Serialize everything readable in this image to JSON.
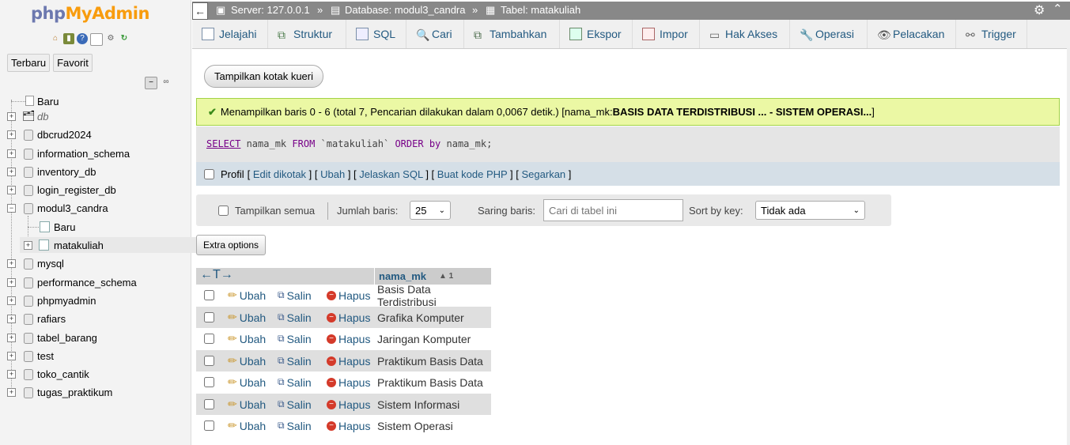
{
  "sidebar": {
    "logo_part1": "php",
    "logo_part2": "MyAdmin",
    "tabs": [
      "Terbaru",
      "Favorit"
    ],
    "tree": [
      {
        "label": "Baru",
        "italic": false
      },
      {
        "label": "db",
        "italic": true
      },
      {
        "label": "dbcrud2024",
        "italic": false
      },
      {
        "label": "information_schema",
        "italic": false
      },
      {
        "label": "inventory_db",
        "italic": false
      },
      {
        "label": "login_register_db",
        "italic": false
      },
      {
        "label": "modul3_candra",
        "italic": false
      },
      {
        "label": "Baru",
        "italic": false
      },
      {
        "label": "matakuliah",
        "italic": false
      },
      {
        "label": "mysql",
        "italic": false
      },
      {
        "label": "performance_schema",
        "italic": false
      },
      {
        "label": "phpmyadmin",
        "italic": false
      },
      {
        "label": "rafiars",
        "italic": false
      },
      {
        "label": "tabel_barang",
        "italic": false
      },
      {
        "label": "test",
        "italic": false
      },
      {
        "label": "toko_cantik",
        "italic": false
      },
      {
        "label": "tugas_praktikum",
        "italic": false
      }
    ]
  },
  "breadcrumb": {
    "server": "Server: 127.0.0.1",
    "database": "Database: modul3_candra",
    "table": "Tabel: matakuliah",
    "sep": "»"
  },
  "tabs": [
    "Jelajahi",
    "Struktur",
    "SQL",
    "Cari",
    "Tambahkan",
    "Ekspor",
    "Impor",
    "Hak Akses",
    "Operasi",
    "Pelacakan",
    "Trigger"
  ],
  "query_button": "Tampilkan kotak kueri",
  "success": {
    "text": "Menampilkan baris 0 - 6 (total 7, Pencarian dilakukan dalam 0,0067 detik.) [nama_mk: ",
    "bold": "BASIS DATA TERDISTRIBUSI ... - SISTEM OPERASI...",
    "end": "]"
  },
  "sql": {
    "select": "SELECT",
    "rest1": " nama_mk ",
    "from": "FROM",
    "table": " `matakuliah` ",
    "order": "ORDER",
    "by": "by",
    "rest2": " nama_mk;"
  },
  "profile": {
    "label": "Profil",
    "links": [
      "Edit dikotak",
      "Ubah",
      "Jelaskan SQL",
      "Buat kode PHP",
      "Segarkan"
    ]
  },
  "nav": {
    "show_all": "Tampilkan semua",
    "rows_label": "Jumlah baris:",
    "rows_value": "25",
    "filter_label": "Saring baris:",
    "filter_placeholder": "Cari di tabel ini",
    "sort_label": "Sort by key:",
    "sort_value": "Tidak ada"
  },
  "extra_options": "Extra options",
  "table": {
    "arrows": "←T→",
    "column": "nama_mk",
    "sort_indicator": "▲ 1",
    "actions": {
      "edit": "Ubah",
      "copy": "Salin",
      "delete": "Hapus"
    },
    "rows": [
      "Basis Data Terdistribusi",
      "Grafika Komputer",
      "Jaringan Komputer",
      "Praktikum Basis Data",
      "Praktikum Basis Data",
      "Sistem Informasi",
      "Sistem Operasi"
    ]
  },
  "colors": {
    "link": "#235a81",
    "success_bg": "#ebf8a4",
    "topbar": "#888888"
  }
}
